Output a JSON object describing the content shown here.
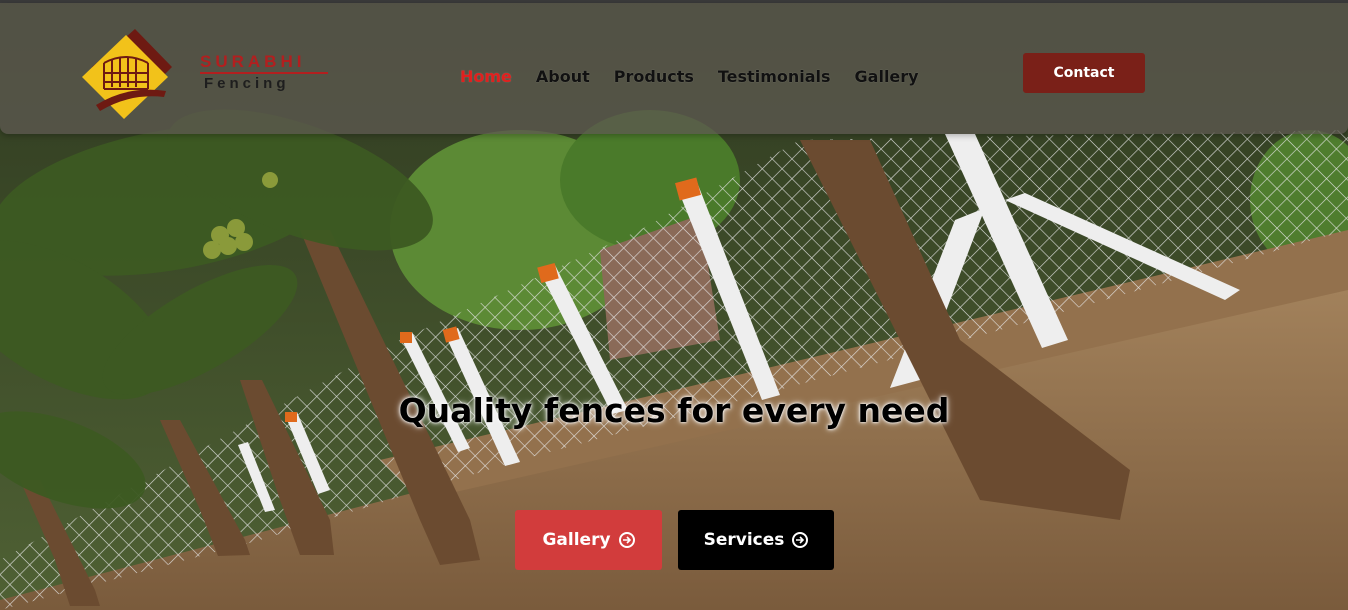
{
  "brand": {
    "name": "SURABHI",
    "tagline": "Fencing",
    "logo_icon": "fence-logo-icon",
    "colors": {
      "primary_red": "#b21f1f",
      "logo_yellow": "#f2c21a",
      "logo_maroon": "#6e1a12"
    }
  },
  "nav": {
    "items": [
      {
        "label": "Home",
        "active": true
      },
      {
        "label": "About",
        "active": false
      },
      {
        "label": "Products",
        "active": false
      },
      {
        "label": "Testimonials",
        "active": false
      },
      {
        "label": "Gallery",
        "active": false
      }
    ],
    "active_color": "#e0201e"
  },
  "header": {
    "contact_label": "Contact",
    "contact_color": "#7a2018"
  },
  "hero": {
    "headline": "Quality fences for every need",
    "buttons": [
      {
        "label": "Gallery",
        "icon": "arrow-circle-right-icon",
        "color": "#d23c3c"
      },
      {
        "label": "Services",
        "icon": "arrow-circle-right-icon",
        "color": "#000000"
      }
    ],
    "background": "photo of coconut palms beside a chain-link fence with concrete posts"
  }
}
